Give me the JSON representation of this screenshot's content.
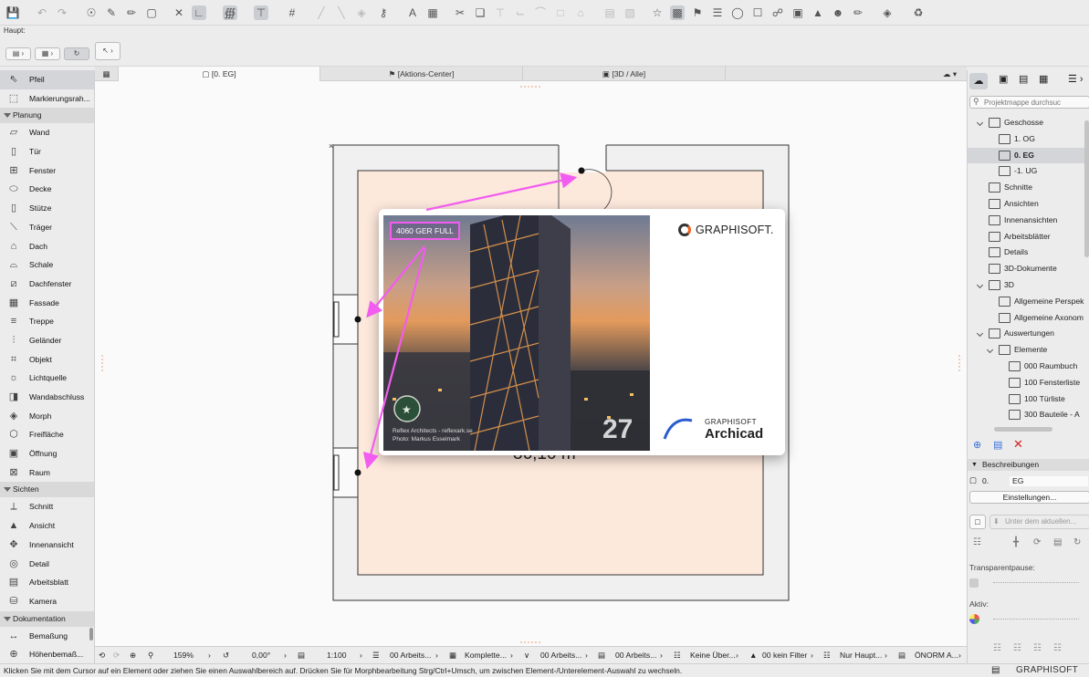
{
  "toolbar": {
    "haupt_label": "Haupt:"
  },
  "tabs": [
    {
      "label": "[0. EG]"
    },
    {
      "label": "[Aktions-Center]"
    },
    {
      "label": "[3D / Alle]"
    }
  ],
  "left_palette": {
    "top_items": [
      "Pfeil",
      "Markierungsrah..."
    ],
    "sections": [
      {
        "title": "Planung",
        "items": [
          "Wand",
          "Tür",
          "Fenster",
          "Decke",
          "Stütze",
          "Träger",
          "Dach",
          "Schale",
          "Dachfenster",
          "Fassade",
          "Treppe",
          "Geländer",
          "Objekt",
          "Lichtquelle",
          "Wandabschluss",
          "Morph",
          "Freifläche",
          "Öffnung",
          "Raum"
        ]
      },
      {
        "title": "Sichten",
        "items": [
          "Schnitt",
          "Ansicht",
          "Innenansicht",
          "Detail",
          "Arbeitsblatt",
          "Kamera"
        ]
      },
      {
        "title": "Dokumentation",
        "items": [
          "Bemaßung",
          "Höhenbemaß..."
        ]
      }
    ]
  },
  "navigator": {
    "search_placeholder": "Projektmappe durchsuc",
    "tree": [
      {
        "label": "Geschosse",
        "level": 0,
        "expand": true
      },
      {
        "label": "1. OG",
        "level": 1
      },
      {
        "label": "0. EG",
        "level": 1,
        "selected": true
      },
      {
        "label": "-1. UG",
        "level": 1
      },
      {
        "label": "Schnitte",
        "level": 0
      },
      {
        "label": "Ansichten",
        "level": 0
      },
      {
        "label": "Innenansichten",
        "level": 0
      },
      {
        "label": "Arbeitsblätter",
        "level": 0
      },
      {
        "label": "Details",
        "level": 0
      },
      {
        "label": "3D-Dokumente",
        "level": 0
      },
      {
        "label": "3D",
        "level": 0,
        "expand": true
      },
      {
        "label": "Allgemeine Perspek",
        "level": 1
      },
      {
        "label": "Allgemeine Axonom",
        "level": 1
      },
      {
        "label": "Auswertungen",
        "level": 0,
        "expand": true
      },
      {
        "label": "Elemente",
        "level": 1,
        "expand": true
      },
      {
        "label": "000 Raumbuch",
        "level": 2
      },
      {
        "label": "100 Fensterliste",
        "level": 2
      },
      {
        "label": "100 Türliste",
        "level": 2
      },
      {
        "label": "300 Bauteile - A",
        "level": 2
      }
    ],
    "beschreibungen": "Beschreibungen",
    "desc_id": "0.",
    "desc_name": "EG",
    "settings_button": "Einstellungen...",
    "view_dropdown": "Unter dem aktuellen...",
    "transparent_label": "Transparentpause:",
    "aktiv_label": "Aktiv:"
  },
  "canvas": {
    "room_area": "36,10 m²"
  },
  "splash": {
    "badge": "4060 GER FULL",
    "brand": "GRAPHISOFT.",
    "version": "27",
    "credit_line1": "Reflex Architects - reflexark.se",
    "credit_line2": "Photo: Markus Esselmark",
    "product_brand": "GRAPHISOFT",
    "product_name": "Archicad"
  },
  "status_bar": {
    "zoom": "159%",
    "angle": "0,00°",
    "scale": "1:100",
    "layer_combo": "00 Arbeits...",
    "model_view": "Komplette...",
    "pen_set": "00 Arbeits...",
    "mvo": "00 Arbeits...",
    "renovation": "Keine Über...",
    "filter": "00 kein Filter",
    "structure": "Nur Haupt...",
    "dimension": "ÖNORM A..."
  },
  "hint_text": "Klicken Sie mit dem Cursor auf ein Element oder ziehen Sie einen Auswahlbereich auf. Drücken Sie für Morphbearbeitung Strg/Ctrl+Umsch, um zwischen Element-/Unterelement-Auswahl zu wechseln.",
  "footer_brand": "GRAPHISOFT ID",
  "colors": {
    "accent_arrow": "#f25cf0",
    "room_fill": "#fde8dc",
    "selection": "#c9ccd1"
  }
}
